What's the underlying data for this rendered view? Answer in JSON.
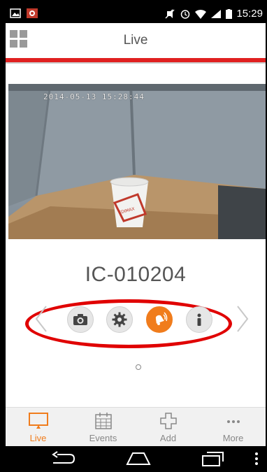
{
  "status_bar": {
    "time": "15:29",
    "icons": [
      "image-icon",
      "app-notification-icon",
      "mute-icon",
      "alarm-icon",
      "wifi-icon",
      "signal-icon",
      "battery-icon"
    ]
  },
  "header": {
    "title": "Live",
    "menu_icon": "grid-menu-icon",
    "accent_color": "#e02020"
  },
  "camera": {
    "timestamp": "2014-05-13 15:28:44",
    "device_name": "IC-010204"
  },
  "controls": {
    "items": [
      {
        "name": "snapshot",
        "icon": "camera-icon",
        "active": false
      },
      {
        "name": "settings",
        "icon": "gear-icon",
        "active": false
      },
      {
        "name": "alarm",
        "icon": "bell-icon",
        "active": true
      },
      {
        "name": "info",
        "icon": "info-icon",
        "active": false
      }
    ],
    "active_color": "#f07c1c",
    "highlight_color": "#e00000"
  },
  "pager": {
    "current": 1,
    "total": 1
  },
  "tabs": [
    {
      "label": "Live",
      "icon": "monitor-icon",
      "active": true
    },
    {
      "label": "Events",
      "icon": "calendar-icon",
      "active": false
    },
    {
      "label": "Add",
      "icon": "plus-icon",
      "active": false
    },
    {
      "label": "More",
      "icon": "more-icon",
      "active": false
    }
  ],
  "nav_bar": {
    "icons": [
      "back-icon",
      "home-icon",
      "recents-icon",
      "overflow-icon"
    ]
  }
}
